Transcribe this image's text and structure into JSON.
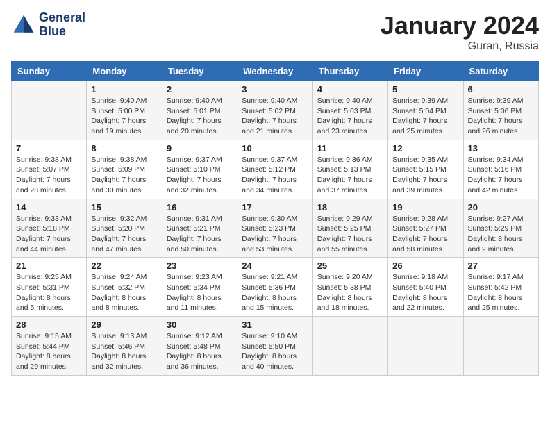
{
  "header": {
    "logo_line1": "General",
    "logo_line2": "Blue",
    "month": "January 2024",
    "location": "Guran, Russia"
  },
  "weekdays": [
    "Sunday",
    "Monday",
    "Tuesday",
    "Wednesday",
    "Thursday",
    "Friday",
    "Saturday"
  ],
  "weeks": [
    [
      {
        "day": "",
        "info": ""
      },
      {
        "day": "1",
        "info": "Sunrise: 9:40 AM\nSunset: 5:00 PM\nDaylight: 7 hours\nand 19 minutes."
      },
      {
        "day": "2",
        "info": "Sunrise: 9:40 AM\nSunset: 5:01 PM\nDaylight: 7 hours\nand 20 minutes."
      },
      {
        "day": "3",
        "info": "Sunrise: 9:40 AM\nSunset: 5:02 PM\nDaylight: 7 hours\nand 21 minutes."
      },
      {
        "day": "4",
        "info": "Sunrise: 9:40 AM\nSunset: 5:03 PM\nDaylight: 7 hours\nand 23 minutes."
      },
      {
        "day": "5",
        "info": "Sunrise: 9:39 AM\nSunset: 5:04 PM\nDaylight: 7 hours\nand 25 minutes."
      },
      {
        "day": "6",
        "info": "Sunrise: 9:39 AM\nSunset: 5:06 PM\nDaylight: 7 hours\nand 26 minutes."
      }
    ],
    [
      {
        "day": "7",
        "info": "Sunrise: 9:38 AM\nSunset: 5:07 PM\nDaylight: 7 hours\nand 28 minutes."
      },
      {
        "day": "8",
        "info": "Sunrise: 9:38 AM\nSunset: 5:09 PM\nDaylight: 7 hours\nand 30 minutes."
      },
      {
        "day": "9",
        "info": "Sunrise: 9:37 AM\nSunset: 5:10 PM\nDaylight: 7 hours\nand 32 minutes."
      },
      {
        "day": "10",
        "info": "Sunrise: 9:37 AM\nSunset: 5:12 PM\nDaylight: 7 hours\nand 34 minutes."
      },
      {
        "day": "11",
        "info": "Sunrise: 9:36 AM\nSunset: 5:13 PM\nDaylight: 7 hours\nand 37 minutes."
      },
      {
        "day": "12",
        "info": "Sunrise: 9:35 AM\nSunset: 5:15 PM\nDaylight: 7 hours\nand 39 minutes."
      },
      {
        "day": "13",
        "info": "Sunrise: 9:34 AM\nSunset: 5:16 PM\nDaylight: 7 hours\nand 42 minutes."
      }
    ],
    [
      {
        "day": "14",
        "info": "Sunrise: 9:33 AM\nSunset: 5:18 PM\nDaylight: 7 hours\nand 44 minutes."
      },
      {
        "day": "15",
        "info": "Sunrise: 9:32 AM\nSunset: 5:20 PM\nDaylight: 7 hours\nand 47 minutes."
      },
      {
        "day": "16",
        "info": "Sunrise: 9:31 AM\nSunset: 5:21 PM\nDaylight: 7 hours\nand 50 minutes."
      },
      {
        "day": "17",
        "info": "Sunrise: 9:30 AM\nSunset: 5:23 PM\nDaylight: 7 hours\nand 53 minutes."
      },
      {
        "day": "18",
        "info": "Sunrise: 9:29 AM\nSunset: 5:25 PM\nDaylight: 7 hours\nand 55 minutes."
      },
      {
        "day": "19",
        "info": "Sunrise: 9:28 AM\nSunset: 5:27 PM\nDaylight: 7 hours\nand 58 minutes."
      },
      {
        "day": "20",
        "info": "Sunrise: 9:27 AM\nSunset: 5:29 PM\nDaylight: 8 hours\nand 2 minutes."
      }
    ],
    [
      {
        "day": "21",
        "info": "Sunrise: 9:25 AM\nSunset: 5:31 PM\nDaylight: 8 hours\nand 5 minutes."
      },
      {
        "day": "22",
        "info": "Sunrise: 9:24 AM\nSunset: 5:32 PM\nDaylight: 8 hours\nand 8 minutes."
      },
      {
        "day": "23",
        "info": "Sunrise: 9:23 AM\nSunset: 5:34 PM\nDaylight: 8 hours\nand 11 minutes."
      },
      {
        "day": "24",
        "info": "Sunrise: 9:21 AM\nSunset: 5:36 PM\nDaylight: 8 hours\nand 15 minutes."
      },
      {
        "day": "25",
        "info": "Sunrise: 9:20 AM\nSunset: 5:38 PM\nDaylight: 8 hours\nand 18 minutes."
      },
      {
        "day": "26",
        "info": "Sunrise: 9:18 AM\nSunset: 5:40 PM\nDaylight: 8 hours\nand 22 minutes."
      },
      {
        "day": "27",
        "info": "Sunrise: 9:17 AM\nSunset: 5:42 PM\nDaylight: 8 hours\nand 25 minutes."
      }
    ],
    [
      {
        "day": "28",
        "info": "Sunrise: 9:15 AM\nSunset: 5:44 PM\nDaylight: 8 hours\nand 29 minutes."
      },
      {
        "day": "29",
        "info": "Sunrise: 9:13 AM\nSunset: 5:46 PM\nDaylight: 8 hours\nand 32 minutes."
      },
      {
        "day": "30",
        "info": "Sunrise: 9:12 AM\nSunset: 5:48 PM\nDaylight: 8 hours\nand 36 minutes."
      },
      {
        "day": "31",
        "info": "Sunrise: 9:10 AM\nSunset: 5:50 PM\nDaylight: 8 hours\nand 40 minutes."
      },
      {
        "day": "",
        "info": ""
      },
      {
        "day": "",
        "info": ""
      },
      {
        "day": "",
        "info": ""
      }
    ]
  ]
}
